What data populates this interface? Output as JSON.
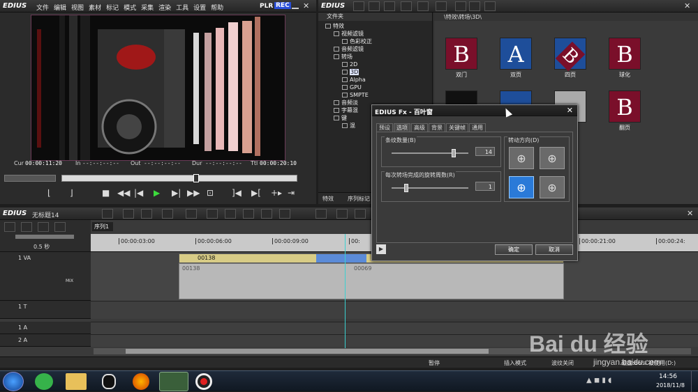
{
  "player": {
    "app_name": "EDIUS",
    "menu": [
      "文件",
      "编辑",
      "视图",
      "素材",
      "标记",
      "模式",
      "采集",
      "渲染",
      "工具",
      "设置",
      "帮助"
    ],
    "plr_label": "PLR",
    "rec_label": "REC",
    "timecodes": [
      {
        "label": "Cur",
        "value": "00:00:11:20"
      },
      {
        "label": "In",
        "value": "--:--:--:--"
      },
      {
        "label": "Out",
        "value": "--:--:--:--"
      },
      {
        "label": "Dur",
        "value": "--:--:--:--"
      },
      {
        "label": "Ttl",
        "value": "00:00:20:10"
      }
    ]
  },
  "bin": {
    "app_name": "EDIUS",
    "folder_header": "文件夹",
    "path": "\\特效\\转场\\3D\\",
    "tree": [
      {
        "label": "特效",
        "indent": 0
      },
      {
        "label": "视频滤镜",
        "indent": 1
      },
      {
        "label": "色彩校正",
        "indent": 2
      },
      {
        "label": "音频滤镜",
        "indent": 1
      },
      {
        "label": "转场",
        "indent": 1
      },
      {
        "label": "2D",
        "indent": 2
      },
      {
        "label": "3D",
        "indent": 2
      },
      {
        "label": "Alpha",
        "indent": 2
      },
      {
        "label": "GPU",
        "indent": 2
      },
      {
        "label": "SMPTE",
        "indent": 2
      },
      {
        "label": "音频淡",
        "indent": 1
      },
      {
        "label": "字幕混",
        "indent": 1
      },
      {
        "label": "键",
        "indent": 1
      },
      {
        "label": "混",
        "indent": 2
      }
    ],
    "bottom_tabs": [
      "特效",
      "序列标记"
    ],
    "effects": [
      {
        "name": "双门",
        "glyph": "B"
      },
      {
        "name": "双页",
        "glyph": "A"
      },
      {
        "name": "四页",
        "glyph": "B"
      },
      {
        "name": "球化",
        "glyph": "B"
      },
      {
        "name": "翻页",
        "glyph": "B"
      }
    ]
  },
  "dialog": {
    "title": "EDIUS Fx - 百叶窗",
    "tabs": [
      "预设",
      "选项",
      "高级",
      "背景",
      "关键帧",
      "通用"
    ],
    "strip_count_label": "条纹数量(B)",
    "strip_count_value": "14",
    "rotation_label": "每次转场完成的旋转周数(R)",
    "rotation_value": "1",
    "direction_label": "转动方向(D)",
    "ok_label": "确定",
    "cancel_label": "取消"
  },
  "timeline": {
    "app_name": "EDIUS",
    "project_title": "无标题14",
    "sequence_tab": "序列1",
    "zoom_label": "0.5 秒",
    "ruler_ticks": [
      "00:00:03:00",
      "00:00:06:00",
      "00:00:09:00",
      "00:",
      "00:00:21:00",
      "00:00:24:"
    ],
    "tracks": [
      {
        "name": "1 VA"
      },
      {
        "name": "1 T"
      },
      {
        "name": "1 A"
      },
      {
        "name": "2 A"
      }
    ],
    "clip_video_label": "00138",
    "clip_audio_label": "00138",
    "clip_audio_label2": "00069",
    "mix_label": "MIX"
  },
  "statusbar": {
    "items": [
      "暂停",
      "插入模式",
      "波纹关闭",
      "磁盘:66% 被使用(D:)"
    ]
  },
  "taskbar": {
    "clock_time": "14:56",
    "clock_date": "2018/11/8"
  },
  "watermark": {
    "brand": "Bai du 经验",
    "url": "jingyan.baidu.com"
  }
}
